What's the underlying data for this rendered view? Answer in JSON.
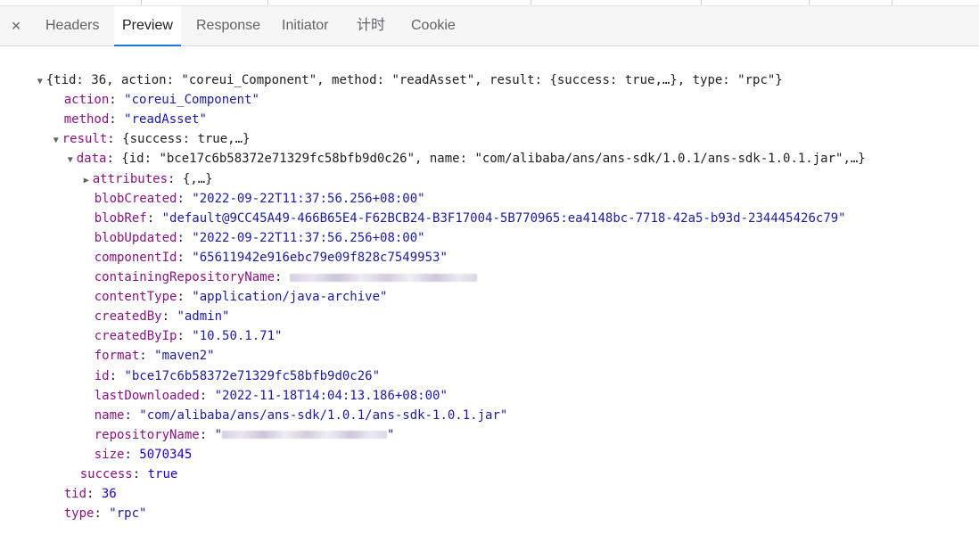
{
  "tabs": {
    "close": "×",
    "items": [
      "Headers",
      "Preview",
      "Response",
      "Initiator",
      "计时",
      "Cookie"
    ],
    "active": "Preview"
  },
  "root": {
    "summary": "{tid: 36, action: \"coreui_Component\", method: \"readAsset\", result: {success: true,…}, type: \"rpc\"}",
    "action_key": "action",
    "action_val": "\"coreui_Component\"",
    "method_key": "method",
    "method_val": "\"readAsset\"",
    "result_key": "result",
    "result_summary": "{success: true,…}",
    "tid_key": "tid",
    "tid_val": "36",
    "type_key": "type",
    "type_val": "\"rpc\""
  },
  "result": {
    "data_key": "data",
    "data_summary": "{id: \"bce17c6b58372e71329fc58bfb9d0c26\", name: \"com/alibaba/ans/ans-sdk/1.0.1/ans-sdk-1.0.1.jar\",…}",
    "success_key": "success",
    "success_val": "true"
  },
  "data": [
    {
      "key": "attributes",
      "val": "{,…}",
      "kind": "p",
      "expandable": true
    },
    {
      "key": "blobCreated",
      "val": "\"2022-09-22T11:37:56.256+08:00\"",
      "kind": "s"
    },
    {
      "key": "blobRef",
      "val": "\"default@9CC45A49-466B65E4-F62BCB24-B3F17004-5B770965:ea4148bc-7718-42a5-b93d-234445426c79\"",
      "kind": "s"
    },
    {
      "key": "blobUpdated",
      "val": "\"2022-09-22T11:37:56.256+08:00\"",
      "kind": "s"
    },
    {
      "key": "componentId",
      "val": "\"65611942e916ebc79e09f828c7549953\"",
      "kind": "s"
    },
    {
      "key": "containingRepositoryName",
      "val": "",
      "kind": "redacted"
    },
    {
      "key": "contentType",
      "val": "\"application/java-archive\"",
      "kind": "s"
    },
    {
      "key": "createdBy",
      "val": "\"admin\"",
      "kind": "s"
    },
    {
      "key": "createdByIp",
      "val": "\"10.50.1.71\"",
      "kind": "s"
    },
    {
      "key": "format",
      "val": "\"maven2\"",
      "kind": "s"
    },
    {
      "key": "id",
      "val": "\"bce17c6b58372e71329fc58bfb9d0c26\"",
      "kind": "s"
    },
    {
      "key": "lastDownloaded",
      "val": "\"2022-11-18T14:04:13.186+08:00\"",
      "kind": "s"
    },
    {
      "key": "name",
      "val": "\"com/alibaba/ans/ans-sdk/1.0.1/ans-sdk-1.0.1.jar\"",
      "kind": "s"
    },
    {
      "key": "repositoryName",
      "val": "\"\"",
      "kind": "redacted-quoted"
    },
    {
      "key": "size",
      "val": "5070345",
      "kind": "n"
    }
  ]
}
